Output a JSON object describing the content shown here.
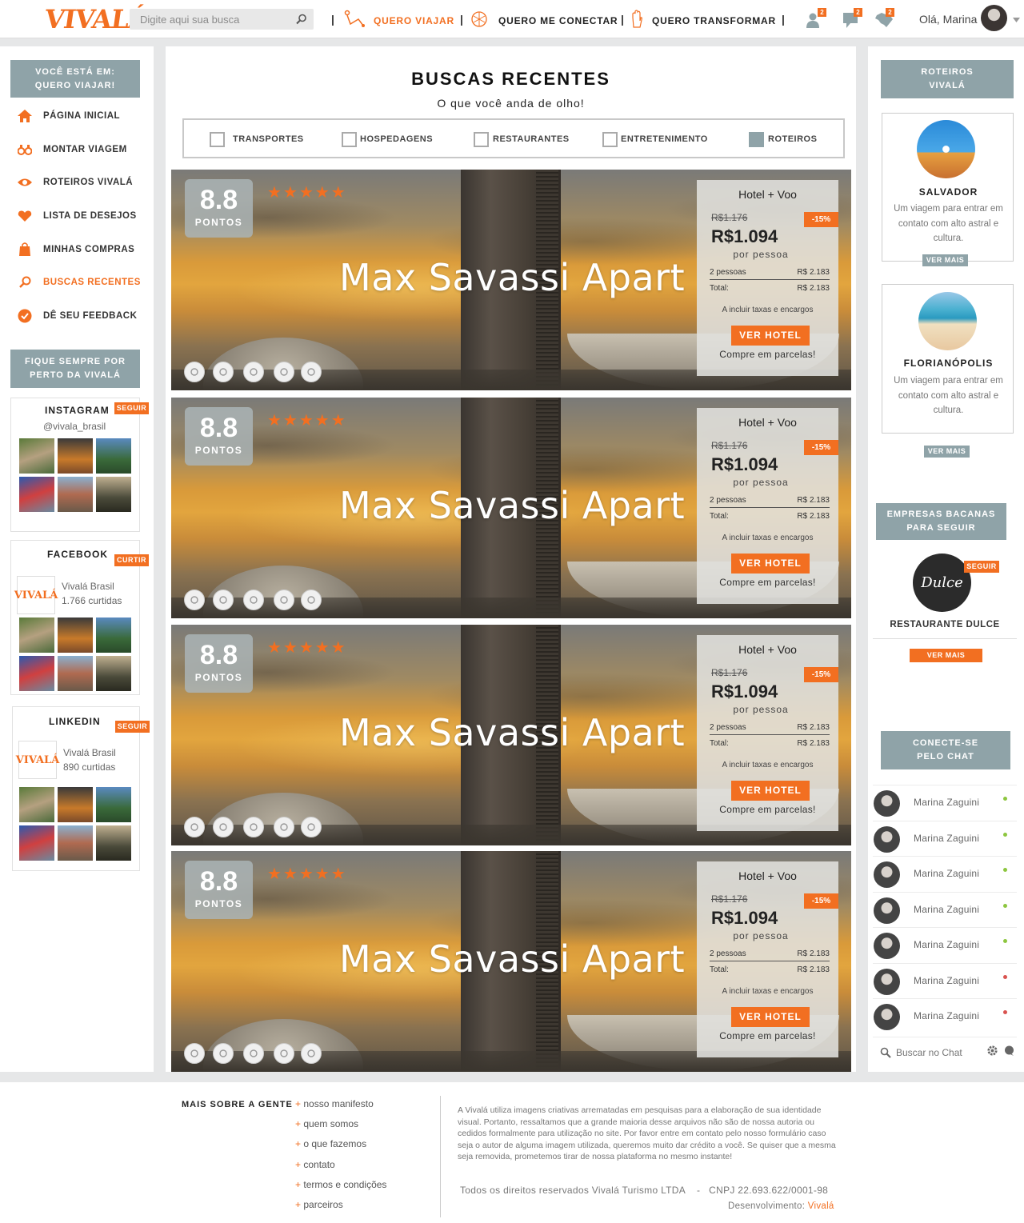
{
  "header": {
    "logo": "VIVALÁ",
    "search_placeholder": "Digite aqui sua busca",
    "nav": [
      "QUERO VIAJAR",
      "QUERO ME CONECTAR",
      "QUERO TRANSFORMAR"
    ],
    "badges": [
      "2",
      "2",
      "2"
    ],
    "greeting": "Olá, Marina"
  },
  "sidebar": {
    "location_box": "VOCÊ ESTÁ EM:\nQUERO VIAJAR!",
    "menu": [
      {
        "label": "PÁGINA INICIAL",
        "icon": "home-icon"
      },
      {
        "label": "MONTAR VIAGEM",
        "icon": "binoculars-icon"
      },
      {
        "label": "ROTEIROS VIVALÁ",
        "icon": "eye-icon"
      },
      {
        "label": "LISTA DE DESEJOS",
        "icon": "heart-icon"
      },
      {
        "label": "MINHAS COMPRAS",
        "icon": "shopping-bag-icon"
      },
      {
        "label": "BUSCAS RECENTES",
        "icon": "search-icon"
      },
      {
        "label": "DÊ SEU FEEDBACK",
        "icon": "check-circle-icon"
      }
    ],
    "follow_box": "FIQUE SEMPRE POR\nPERTO DA VIVALÁ",
    "instagram": {
      "title": "INSTAGRAM",
      "button": "SEGUIR",
      "handle": "@vivala_brasil"
    },
    "facebook": {
      "title": "FACEBOOK",
      "button": "CURTIR",
      "name": "Vivalá Brasil",
      "count": "1.766 curtidas"
    },
    "linkedin": {
      "title": "LINKEDIN",
      "button": "SEGUIR",
      "name": "Vivalá Brasil",
      "count": "890 curtidas"
    }
  },
  "main": {
    "title": "BUSCAS RECENTES",
    "subtitle": "O que você anda de olho!",
    "filters": [
      {
        "label": "TRANSPORTES",
        "checked": false
      },
      {
        "label": "HOSPEDAGENS",
        "checked": false
      },
      {
        "label": "RESTAURANTES",
        "checked": false
      },
      {
        "label": "ENTRETENIMENTO",
        "checked": false
      },
      {
        "label": "ROTEIROS",
        "checked": true
      }
    ],
    "cards": [
      {
        "score": "8.8",
        "score_label": "PONTOS",
        "stars": "★★★★★",
        "name": "Max Savassi Apart",
        "package": "Hotel + Voo",
        "old_price": "R$1.176",
        "discount": "-15%",
        "price": "R$1.094",
        "per": "por pessoa",
        "people_label": "2 pessoas",
        "people_value": "R$ 2.183",
        "total_label": "Total:",
        "total_value": "R$ 2.183",
        "taxes": "A incluir taxas e encargos",
        "button": "VER HOTEL",
        "installments": "Compre em parcelas!"
      },
      {
        "score": "8.8",
        "score_label": "PONTOS",
        "stars": "★★★★★",
        "name": "Max Savassi Apart",
        "package": "Hotel + Voo",
        "old_price": "R$1.176",
        "discount": "-15%",
        "price": "R$1.094",
        "per": "por pessoa",
        "people_label": "2 pessoas",
        "people_value": "R$ 2.183",
        "total_label": "Total:",
        "total_value": "R$ 2.183",
        "taxes": "A incluir taxas e encargos",
        "button": "VER HOTEL",
        "installments": "Compre em parcelas!"
      },
      {
        "score": "8.8",
        "score_label": "PONTOS",
        "stars": "★★★★★",
        "name": "Max Savassi Apart",
        "package": "Hotel + Voo",
        "old_price": "R$1.176",
        "discount": "-15%",
        "price": "R$1.094",
        "per": "por pessoa",
        "people_label": "2 pessoas",
        "people_value": "R$ 2.183",
        "total_label": "Total:",
        "total_value": "R$ 2.183",
        "taxes": "A incluir taxas e encargos",
        "button": "VER HOTEL",
        "installments": "Compre em parcelas!"
      },
      {
        "score": "8.8",
        "score_label": "PONTOS",
        "stars": "★★★★★",
        "name": "Max Savassi Apart",
        "package": "Hotel + Voo",
        "old_price": "R$1.176",
        "discount": "-15%",
        "price": "R$1.094",
        "per": "por pessoa",
        "people_label": "2 pessoas",
        "people_value": "R$ 2.183",
        "total_label": "Total:",
        "total_value": "R$ 2.183",
        "taxes": "A incluir taxas e encargos",
        "button": "VER HOTEL",
        "installments": "Compre em parcelas!"
      }
    ],
    "amenities": [
      "wifi-icon",
      "air-conditioning-icon",
      "tv-icon",
      "toilet-paper-icon",
      "towel-icon"
    ]
  },
  "right": {
    "roteiros_box": "ROTEIROS\nVIVALÁ",
    "trips": [
      {
        "name": "SALVADOR",
        "desc": "Um viagem para entrar em contato com alto astral e cultura.",
        "button": "VER MAIS"
      },
      {
        "name": "FLORIANÓPOLIS",
        "desc": "Um viagem para entrar em contato com alto astral e cultura.",
        "button": "VER MAIS"
      }
    ],
    "companies_box": "EMPRESAS BACANAS\nPARA SEGUIR",
    "company": {
      "logo_text": "Dulce",
      "button": "SEGUIR",
      "name": "RESTAURANTE DULCE",
      "more": "VER MAIS"
    },
    "chat_box": "CONECTE-SE\nPELO CHAT",
    "chat": [
      {
        "name": "Marina Zaguini",
        "status": "online"
      },
      {
        "name": "Marina Zaguini",
        "status": "online"
      },
      {
        "name": "Marina Zaguini",
        "status": "online"
      },
      {
        "name": "Marina Zaguini",
        "status": "online"
      },
      {
        "name": "Marina Zaguini",
        "status": "online"
      },
      {
        "name": "Marina Zaguini",
        "status": "offline"
      },
      {
        "name": "Marina Zaguini",
        "status": "offline"
      }
    ],
    "chat_search_placeholder": "Buscar no Chat"
  },
  "footer": {
    "heading": "MAIS SOBRE A GENTE",
    "links": [
      "nosso manifesto",
      "quem somos",
      "o que fazemos",
      "contato",
      "termos e condições",
      "parceiros"
    ],
    "disclaimer": "A Vivalá utiliza imagens criativas arrematadas em pesquisas para a elaboração de sua identidade visual. Portanto, ressaltamos que a grande maioria desse arquivos não são de nossa autoria ou cedidos formalmente para utilização no site. Por favor entre em contato pelo nosso formulário caso seja o autor de alguma imagem utilizada, queremos muito dar crédito a você. Se quiser que a mesma seja removida, prometemos tirar de nossa plataforma no mesmo instante!",
    "rights": "Todos os direitos reservados Vivalá Turismo LTDA    -   CNPJ 22.693.622/0001-98",
    "dev_label": "Desenvolvimento:",
    "dev_name": "Vivalá"
  },
  "colors": {
    "accent": "#f26f21",
    "slate": "#8fa3a8",
    "online": "#8dc63f",
    "offline": "#d9534f"
  }
}
